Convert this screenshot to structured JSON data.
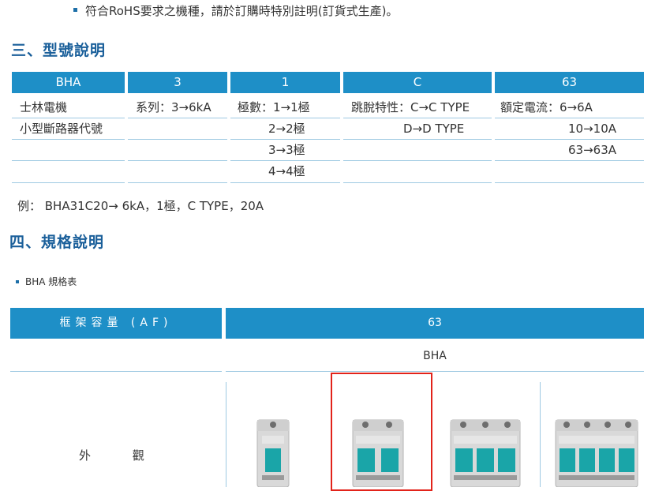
{
  "top_note": "符合RoHS要求之機種，請於訂購時特別註明(訂貨式生產)。",
  "section3_title": "三、型號說明",
  "model_table": {
    "headers": [
      "BHA",
      "3",
      "1",
      "C",
      "63"
    ],
    "col1": [
      "士林電機",
      "小型斷路器代號"
    ],
    "col2": [
      "系列：3→6kA"
    ],
    "col3": [
      "極數：1→1極",
      "2→2極",
      "3→3極",
      "4→4極"
    ],
    "col4": [
      "跳脫特性：C→C TYPE",
      "D→D TYPE"
    ],
    "col5": [
      "額定電流：6→6A",
      "10→10A",
      "63→63A"
    ]
  },
  "example": "例： BHA31C20→ 6kA，1極，C TYPE，20A",
  "section4_title": "四、規格說明",
  "spec_subtitle": "BHA 規格表",
  "spec_table": {
    "frame_label": "框架容量 (AF)",
    "frame_value": "63",
    "series": "BHA",
    "appearance_label": "外 觀",
    "breaker_poles": [
      1,
      2,
      3,
      4
    ]
  },
  "colors": {
    "header_blue": "#1e8fc7",
    "heading_text": "#1a5f9a",
    "highlight_red": "#e2231a",
    "breaker_handle": "#1aa5a8"
  }
}
